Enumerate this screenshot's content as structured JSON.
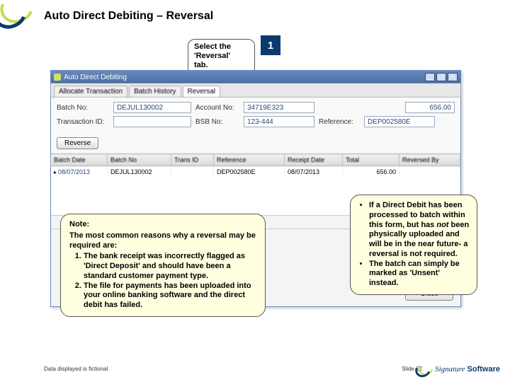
{
  "title": "Auto Direct Debiting – Reversal",
  "step_badge": "1",
  "callout_top_lines": [
    "Select the",
    "'Reversal'",
    "tab."
  ],
  "app": {
    "window_title": "Auto Direct Debiting",
    "tabs": [
      "Allocate Transaction",
      "Batch History",
      "Reversal"
    ],
    "active_tab": 2,
    "fields": {
      "batch_no_label": "Batch No:",
      "batch_no_value": "DEJUL130002",
      "account_no_label": "Account No:",
      "account_no_value": "34719E323",
      "amount_value": "656.00",
      "transaction_id_label": "Transaction ID:",
      "transaction_id_value": "",
      "bsb_no_label": "BSB No:",
      "bsb_no_value": "123-444",
      "reference_label": "Reference:",
      "reference_value": "DEP002580E"
    },
    "reverse_btn": "Reverse",
    "grid_headers": [
      "Batch Date",
      "Batch No",
      "Trans ID",
      "Reference",
      "Receipt Date",
      "Total",
      "Reversed By"
    ],
    "grid_row": {
      "batch_date": "08/07/2013",
      "batch_no": "DEJUL130002",
      "trans_id": "",
      "reference": "DEP002580E",
      "receipt_date": "08/07/2013",
      "total": "656.00",
      "reversed_by": ""
    },
    "close_btn": "Close"
  },
  "note": {
    "heading": "Note:",
    "intro": "The most common reasons why a reversal may be required are:",
    "items": [
      "The bank receipt was incorrectly flagged as 'Direct Deposit' and should have been a standard customer payment type.",
      "The file for payments has been uploaded into your online banking software and the direct debit has failed."
    ]
  },
  "right_note": {
    "items": [
      {
        "pre": "If a Direct Debit has been processed to batch within this form, but has ",
        "em": "not",
        "post": " been physically uploaded and will be in the near future- a reversal is not required."
      },
      {
        "pre": "The batch can simply be marked as 'Unsent' instead.",
        "em": "",
        "post": ""
      }
    ]
  },
  "footer": {
    "disclaimer": "Data displayed is fictional",
    "slide": "Slide 62",
    "logo_sig": "Signature",
    "logo_soft": "Software"
  }
}
